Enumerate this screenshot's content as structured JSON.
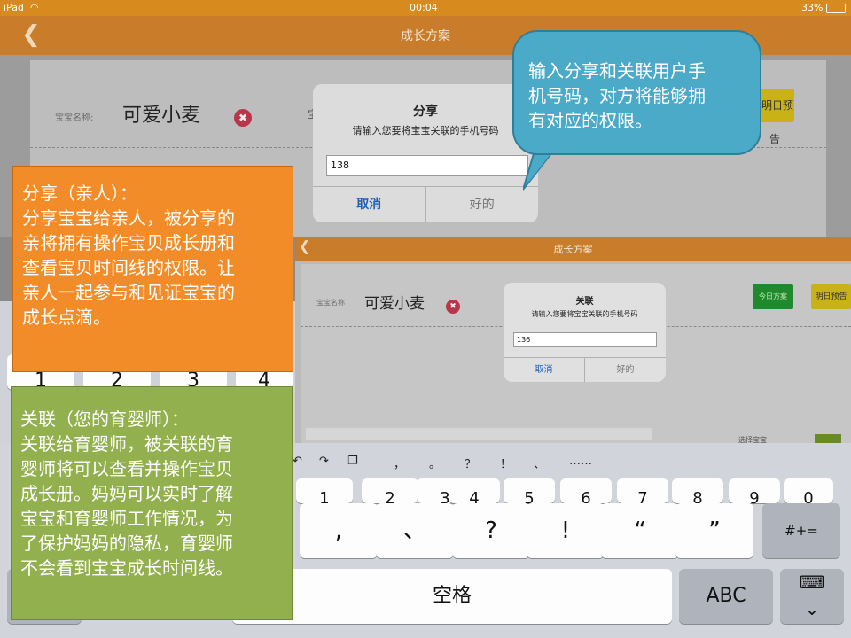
{
  "status_bar": {
    "device": "iPad",
    "wifi_icon": "wifi-icon",
    "time": "00:04",
    "battery": "33%"
  },
  "nav": {
    "title": "成长方案",
    "back_icon": "chevron-left-icon"
  },
  "card": {
    "name_label": "宝宝名称:",
    "baby_name": "可爱小麦",
    "clear_icon": "close-circle-icon",
    "tomorrow_label": "明日预告"
  },
  "share_dialog": {
    "title": "分享",
    "message": "请输入您要将宝宝关联的手机号码",
    "input_value": "138",
    "cancel_label": "取消",
    "ok_label": "好的"
  },
  "shot2": {
    "nav_title": "成长方案",
    "name_label": "宝宝名称",
    "baby_name": "可爱小麦",
    "green_button_label": "今日方案",
    "tomorrow_label": "明日预告",
    "select_label": "选择宝宝",
    "dialog": {
      "title": "关联",
      "message": "请输入您要将宝宝关联的手机号码",
      "input_value": "136",
      "cancel_label": "取消",
      "ok_label": "好的"
    }
  },
  "keyboard": {
    "toolbar": [
      "，",
      "。",
      "？",
      "！",
      "、",
      "……"
    ],
    "left_keys": [
      "1",
      "2",
      "3",
      "4"
    ],
    "number_row": [
      "1",
      "2",
      "3",
      "4",
      "5",
      "6",
      "7",
      "8",
      "9",
      "0"
    ],
    "symbol_row": [
      ",",
      "、",
      "?",
      "!",
      "“",
      "”"
    ],
    "symbol_key": "#+=",
    "space_label": "空格",
    "abc_label": "ABC",
    "dismiss_icon": "keyboard-dismiss-icon"
  },
  "callouts": {
    "share": [
      "分享（亲人）：",
      "分享宝宝给亲人，被分享的",
      "亲将拥有操作宝贝成长册和",
      "查看宝贝时间线的权限。让",
      "亲人一起参与和见证宝宝的",
      "成长点滴。"
    ],
    "link": [
      "关联（您的育婴师）：",
      "关联给育婴师，被关联的育",
      "婴师将可以查看并操作宝贝",
      "成长册。妈妈可以实时了解",
      "宝宝和育婴师工作情况，为",
      "了保护妈妈的隐私，育婴师",
      "不会看到宝宝成长时间线。"
    ],
    "bubble": [
      "输入分享和关联用户手",
      "机号码，对方将能够拥",
      "有对应的权限。"
    ]
  },
  "colors": {
    "orange": "#f28c28",
    "green": "#92b04e",
    "blue": "#4aaac8",
    "nav": "#c97d2a"
  }
}
